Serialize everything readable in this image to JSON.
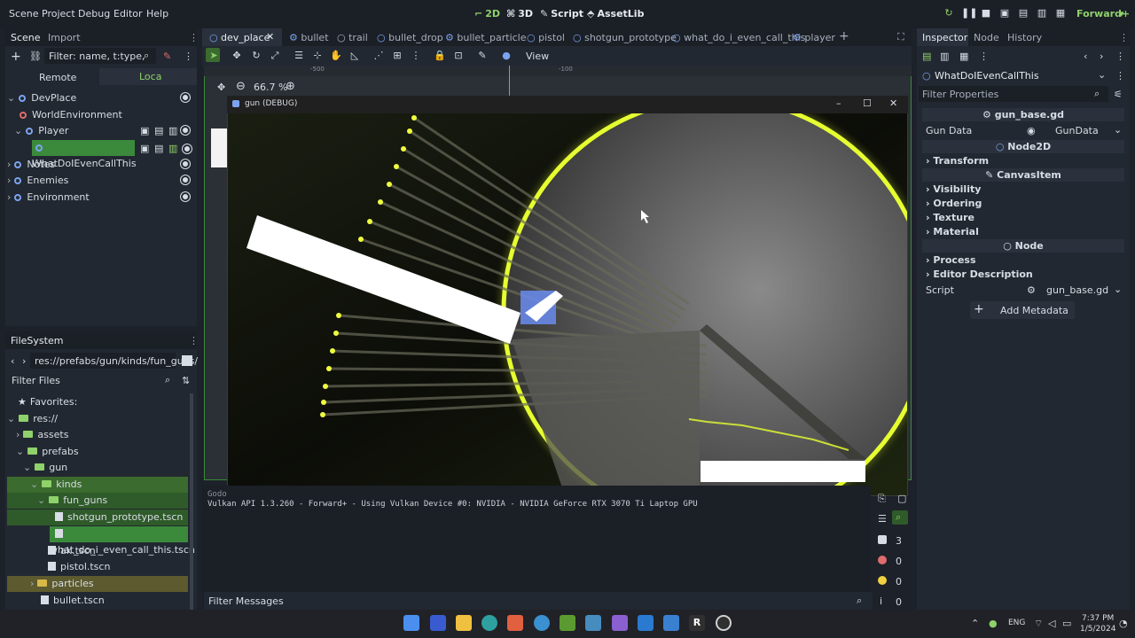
{
  "menu": [
    "Scene",
    "Project",
    "Debug",
    "Editor",
    "Help"
  ],
  "workspaces": {
    "w2d": "2D",
    "w3d": "3D",
    "script": "Script",
    "assetlib": "AssetLib"
  },
  "renderer": "Forward+",
  "scene_dock": {
    "tabs": [
      "Scene",
      "Import"
    ],
    "filter_placeholder": "Filter: name, t:type, g:gr",
    "remote": "Remote",
    "local": "Loca",
    "tree": [
      "DevPlace",
      "WorldEnvironment",
      "Player",
      "WhatDoIEvenCallThis",
      "Notes",
      "Enemies",
      "Environment"
    ]
  },
  "filesystem": {
    "title": "FileSystem",
    "path": "res://prefabs/gun/kinds/fun_guns/",
    "filter_placeholder": "Filter Files",
    "favorites": "Favorites:",
    "items": [
      "res://",
      "assets",
      "prefabs",
      "gun",
      "kinds",
      "fun_guns",
      "shotgun_prototype.tscn",
      "what_do_i_even_call_this.tscn",
      "ak.tscn",
      "pistol.tscn",
      "particles",
      "bullet.tscn"
    ]
  },
  "editor_tabs": [
    "dev_place",
    "bullet",
    "trail",
    "bullet_drop",
    "bullet_particle",
    "pistol",
    "shotgun_prototype",
    "what_do_i_even_call_this",
    "player"
  ],
  "view_menu": "View",
  "zoom": "66.7 %",
  "ruler_marks": [
    "-500",
    "-100"
  ],
  "game_window": {
    "title": "gun (DEBUG)"
  },
  "output": {
    "line1": "Godot Engine v4.3 - https://godotengine.org",
    "line2": "Vulkan API 1.3.260 - Forward+ - Using Vulkan Device #0: NVIDIA - NVIDIA GeForce RTX 3070 Ti Laptop GPU",
    "filter_placeholder": "Filter Messages",
    "counts": {
      "messages": "3",
      "errors": "0",
      "warnings": "0",
      "info": "0"
    }
  },
  "inspector": {
    "tabs": [
      "Inspector",
      "Node",
      "History"
    ],
    "object": "WhatDoIEvenCallThis",
    "filter_placeholder": "Filter Properties",
    "script_header": "gun_base.gd",
    "gun_data_label": "Gun Data",
    "gun_data_value": "GunData",
    "node2d": "Node2D",
    "transform": "Transform",
    "canvas_item": "CanvasItem",
    "visibility": "Visibility",
    "ordering": "Ordering",
    "texture": "Texture",
    "material": "Material",
    "node": "Node",
    "process": "Process",
    "editor_description": "Editor Description",
    "script_label": "Script",
    "script_value": "gun_base.gd",
    "add_metadata": "Add Metadata"
  },
  "taskbar": {
    "time": "7:37 PM",
    "date": "1/5/2024",
    "lang": "ENG"
  },
  "colors": {
    "accent_green": "#3b8a3b",
    "glow_yellow": "#e6ff30",
    "bg": "#1d2129"
  }
}
